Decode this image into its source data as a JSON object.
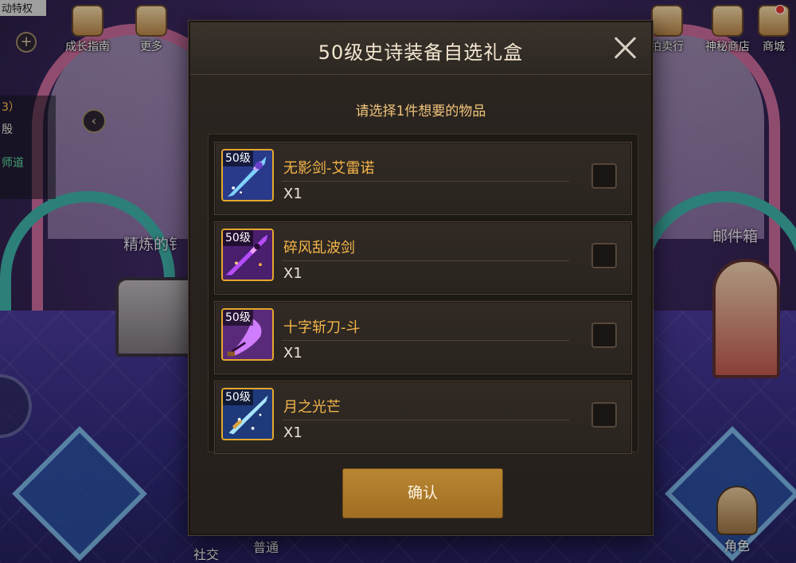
{
  "modal": {
    "title": "50级史诗装备自选礼盒",
    "subtitle": "请选择1件想要的物品",
    "confirm_label": "确认",
    "items": [
      {
        "level": "50级",
        "name": "无影剑-艾雷诺",
        "qty": "X1",
        "checked": false
      },
      {
        "level": "50级",
        "name": "碎风乱波剑",
        "qty": "X1",
        "checked": false
      },
      {
        "level": "50级",
        "name": "十字斩刀-斗",
        "qty": "X1",
        "checked": false
      },
      {
        "level": "50级",
        "name": "月之光芒",
        "qty": "X1",
        "checked": false
      }
    ]
  },
  "hud": {
    "top_left": {
      "growth_guide": "成长指南",
      "more": "更多",
      "truncated_label": "动特权"
    },
    "top_right": {
      "auction": "拍卖行",
      "mystic_shop": "神秘商店",
      "mall": "商城"
    },
    "left_panel": {
      "line1": "3）",
      "line2": "殷",
      "line3": "师道"
    },
    "scene_labels": {
      "refine": "精炼的钅",
      "mailbox": "邮件箱"
    },
    "bottom": {
      "social": "社交",
      "normal": "普通",
      "role": "角色"
    }
  },
  "colors": {
    "item_name": "#f5b64a",
    "subtitle": "#f0c47a",
    "confirm_button": "#b98632",
    "modal_bg": "#2b2520"
  },
  "icons": [
    "close-icon",
    "sword-icon",
    "plus-icon",
    "back-arrow-icon"
  ]
}
